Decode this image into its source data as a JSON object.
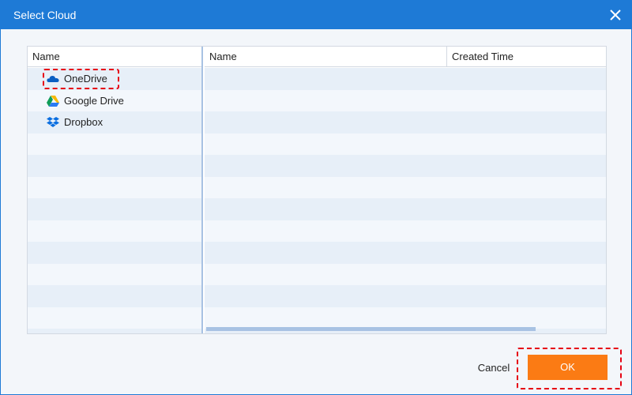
{
  "dialog": {
    "title": "Select Cloud",
    "close_icon": "close-icon"
  },
  "left_pane": {
    "header": "Name",
    "items": [
      {
        "label": "OneDrive",
        "icon": "onedrive-icon",
        "highlighted": true
      },
      {
        "label": "Google Drive",
        "icon": "google-drive-icon",
        "highlighted": false
      },
      {
        "label": "Dropbox",
        "icon": "dropbox-icon",
        "highlighted": false
      }
    ]
  },
  "right_pane": {
    "columns": [
      "Name",
      "Created Time"
    ],
    "rows": []
  },
  "footer": {
    "cancel_label": "Cancel",
    "ok_label": "OK"
  },
  "colors": {
    "titlebar": "#1e7ad6",
    "ok_button": "#fb7b14",
    "highlight": "#e60012",
    "row_alt": "#e7eff8"
  }
}
